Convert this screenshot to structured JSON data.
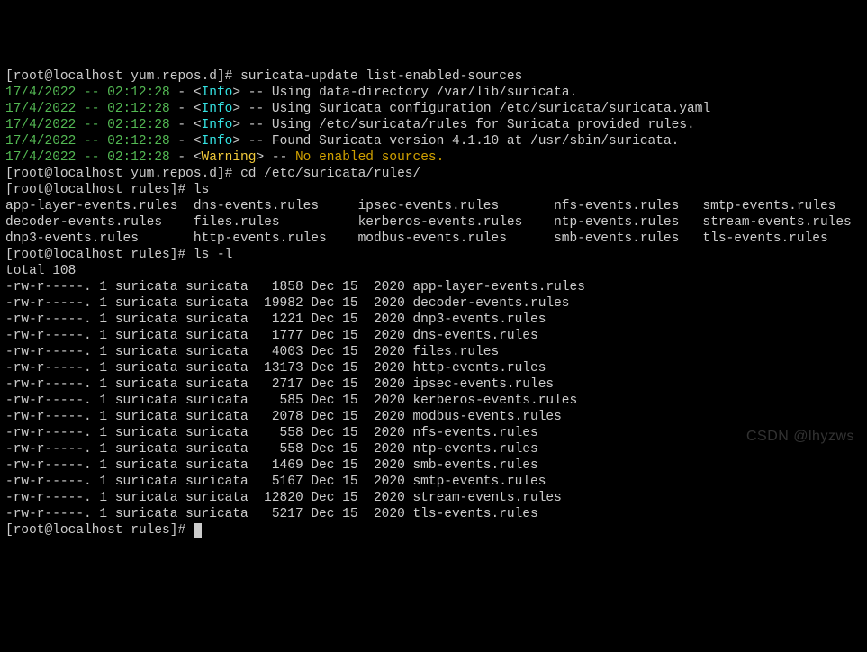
{
  "prompt_user": "root",
  "prompt_host": "localhost",
  "cwd1": "yum.repos.d",
  "cwd2": "rules",
  "cmd1": "suricata-update list-enabled-sources",
  "cmd2": "cd /etc/suricata/rules/",
  "cmd3": "ls",
  "cmd4": "ls -l",
  "timestamp": "17/4/2022 -- 02:12:28",
  "level_info": "Info",
  "level_warn": "Warning",
  "msg_info1": "Using data-directory /var/lib/suricata.",
  "msg_info2": "Using Suricata configuration /etc/suricata/suricata.yaml",
  "msg_info3": "Using /etc/suricata/rules for Suricata provided rules.",
  "msg_info4": "Found Suricata version 4.1.10 at /usr/sbin/suricata.",
  "msg_warn": "No enabled sources.",
  "ls_cols": {
    "c0r0": "app-layer-events.rules",
    "c0r1": "decoder-events.rules",
    "c0r2": "dnp3-events.rules",
    "c1r0": "dns-events.rules",
    "c1r1": "files.rules",
    "c1r2": "http-events.rules",
    "c2r0": "ipsec-events.rules",
    "c2r1": "kerberos-events.rules",
    "c2r2": "modbus-events.rules",
    "c3r0": "nfs-events.rules",
    "c3r1": "ntp-events.rules",
    "c3r2": "smb-events.rules",
    "c4r0": "smtp-events.rules",
    "c4r1": "stream-events.rules",
    "c4r2": "tls-events.rules"
  },
  "total": "total 108",
  "rows": [
    {
      "perm": "-rw-r-----.",
      "n": "1",
      "u": "suricata",
      "g": "suricata",
      "sz": "  1858",
      "d": "Dec 15  2020",
      "f": "app-layer-events.rules"
    },
    {
      "perm": "-rw-r-----.",
      "n": "1",
      "u": "suricata",
      "g": "suricata",
      "sz": " 19982",
      "d": "Dec 15  2020",
      "f": "decoder-events.rules"
    },
    {
      "perm": "-rw-r-----.",
      "n": "1",
      "u": "suricata",
      "g": "suricata",
      "sz": "  1221",
      "d": "Dec 15  2020",
      "f": "dnp3-events.rules"
    },
    {
      "perm": "-rw-r-----.",
      "n": "1",
      "u": "suricata",
      "g": "suricata",
      "sz": "  1777",
      "d": "Dec 15  2020",
      "f": "dns-events.rules"
    },
    {
      "perm": "-rw-r-----.",
      "n": "1",
      "u": "suricata",
      "g": "suricata",
      "sz": "  4003",
      "d": "Dec 15  2020",
      "f": "files.rules"
    },
    {
      "perm": "-rw-r-----.",
      "n": "1",
      "u": "suricata",
      "g": "suricata",
      "sz": " 13173",
      "d": "Dec 15  2020",
      "f": "http-events.rules"
    },
    {
      "perm": "-rw-r-----.",
      "n": "1",
      "u": "suricata",
      "g": "suricata",
      "sz": "  2717",
      "d": "Dec 15  2020",
      "f": "ipsec-events.rules"
    },
    {
      "perm": "-rw-r-----.",
      "n": "1",
      "u": "suricata",
      "g": "suricata",
      "sz": "   585",
      "d": "Dec 15  2020",
      "f": "kerberos-events.rules"
    },
    {
      "perm": "-rw-r-----.",
      "n": "1",
      "u": "suricata",
      "g": "suricata",
      "sz": "  2078",
      "d": "Dec 15  2020",
      "f": "modbus-events.rules"
    },
    {
      "perm": "-rw-r-----.",
      "n": "1",
      "u": "suricata",
      "g": "suricata",
      "sz": "   558",
      "d": "Dec 15  2020",
      "f": "nfs-events.rules"
    },
    {
      "perm": "-rw-r-----.",
      "n": "1",
      "u": "suricata",
      "g": "suricata",
      "sz": "   558",
      "d": "Dec 15  2020",
      "f": "ntp-events.rules"
    },
    {
      "perm": "-rw-r-----.",
      "n": "1",
      "u": "suricata",
      "g": "suricata",
      "sz": "  1469",
      "d": "Dec 15  2020",
      "f": "smb-events.rules"
    },
    {
      "perm": "-rw-r-----.",
      "n": "1",
      "u": "suricata",
      "g": "suricata",
      "sz": "  5167",
      "d": "Dec 15  2020",
      "f": "smtp-events.rules"
    },
    {
      "perm": "-rw-r-----.",
      "n": "1",
      "u": "suricata",
      "g": "suricata",
      "sz": " 12820",
      "d": "Dec 15  2020",
      "f": "stream-events.rules"
    },
    {
      "perm": "-rw-r-----.",
      "n": "1",
      "u": "suricata",
      "g": "suricata",
      "sz": "  5217",
      "d": "Dec 15  2020",
      "f": "tls-events.rules"
    }
  ],
  "watermark": "CSDN @lhyzws"
}
